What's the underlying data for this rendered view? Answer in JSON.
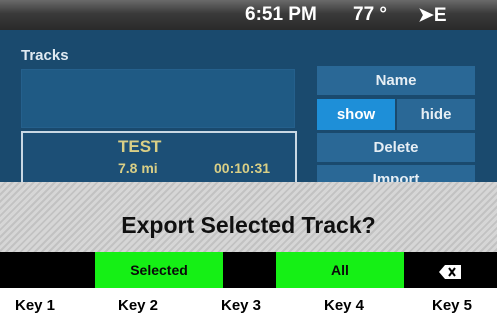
{
  "status": {
    "time": "6:51 PM",
    "temperature": "77 °",
    "heading": "➤E"
  },
  "tracks_title": "Tracks",
  "track": {
    "name": "TEST",
    "distance": "7.8 mi",
    "duration": "00:10:31"
  },
  "side_buttons": {
    "name": "Name",
    "show": "show",
    "hide": "hide",
    "delete": "Delete",
    "import": "Import"
  },
  "dialog": {
    "question": "Export Selected Track?"
  },
  "softkeys": {
    "selected": "Selected",
    "all": "All",
    "backspace_icon": "backspace-icon"
  },
  "key_labels": [
    "Key 1",
    "Key 2",
    "Key 3",
    "Key 4",
    "Key 5"
  ],
  "colors": {
    "background": "#1a4a6e",
    "softkey_green": "#15f015",
    "toggle_active": "#1e8fd8",
    "track_text": "#d9cf86"
  }
}
